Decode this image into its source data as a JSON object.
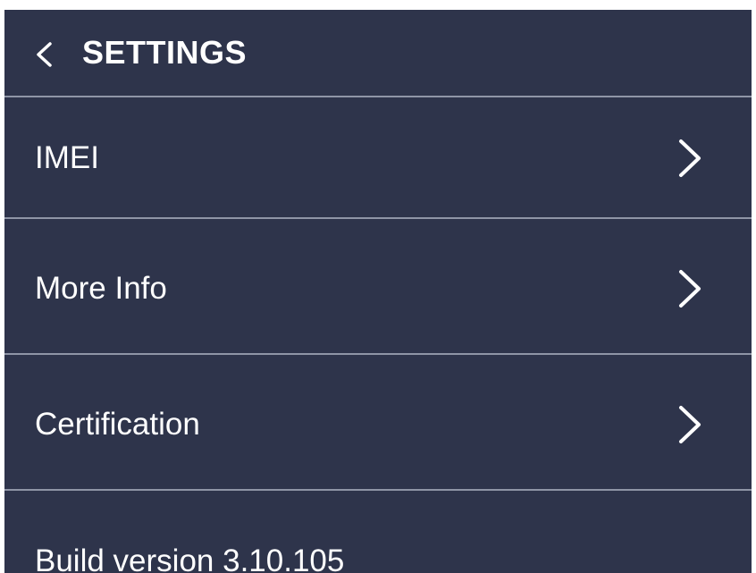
{
  "header": {
    "title": "SETTINGS",
    "back_icon": "chevron-left-icon"
  },
  "menu": {
    "items": [
      {
        "label": "IMEI",
        "icon": "chevron-right-icon"
      },
      {
        "label": "More Info",
        "icon": "chevron-right-icon"
      },
      {
        "label": "Certification",
        "icon": "chevron-right-icon"
      }
    ]
  },
  "footer": {
    "build_version": "Build version 3.10.105"
  },
  "colors": {
    "background": "#2e344b",
    "divider": "#8f95a6",
    "text": "#ffffff"
  }
}
